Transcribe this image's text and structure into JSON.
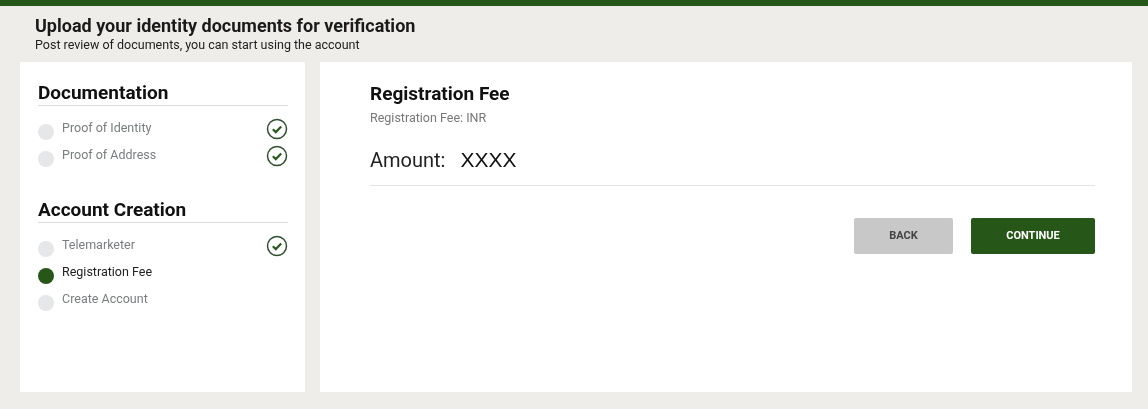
{
  "header": {
    "title": "Upload your identity documents for verification",
    "subtitle": "Post review of documents, you can start using the account"
  },
  "sections": [
    {
      "title": "Documentation",
      "steps": [
        {
          "label": "Proof of Identity",
          "selected": false,
          "completed": true
        },
        {
          "label": "Proof of Address",
          "selected": false,
          "completed": true
        }
      ]
    },
    {
      "title": "Account Creation",
      "steps": [
        {
          "label": "Telemarketer",
          "selected": false,
          "completed": true
        },
        {
          "label": "Registration Fee",
          "selected": true,
          "completed": false
        },
        {
          "label": "Create Account",
          "selected": false,
          "completed": false
        }
      ]
    }
  ],
  "content": {
    "title": "Registration Fee",
    "fee_label": "Registration Fee: INR",
    "amount_label": "Amount:",
    "amount_value": "XXXX"
  },
  "buttons": [
    {
      "kind": "secondary",
      "label": "BACK"
    },
    {
      "kind": "primary",
      "label": "CONTINUE"
    }
  ]
}
